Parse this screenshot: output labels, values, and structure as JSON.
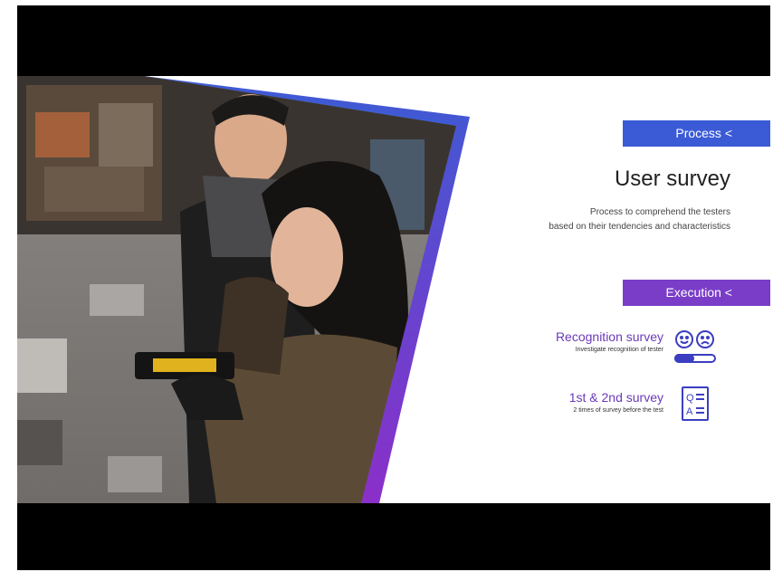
{
  "process": {
    "label": "Process <"
  },
  "title": "User survey",
  "subtitle": {
    "line1": "Process to comprehend the testers",
    "line2": "based on their tendencies and characteristics"
  },
  "execution": {
    "label": "Execution <"
  },
  "items": [
    {
      "title": "Recognition survey",
      "desc": "Investigate recognition of tester",
      "icon": "faces-slider-icon"
    },
    {
      "title": "1st & 2nd survey",
      "desc": "2 times of survey before the test",
      "icon": "qa-document-icon"
    }
  ],
  "colors": {
    "process": "#3b5bd6",
    "execution": "#7a3dc8",
    "accent": "#6a3ab8"
  }
}
